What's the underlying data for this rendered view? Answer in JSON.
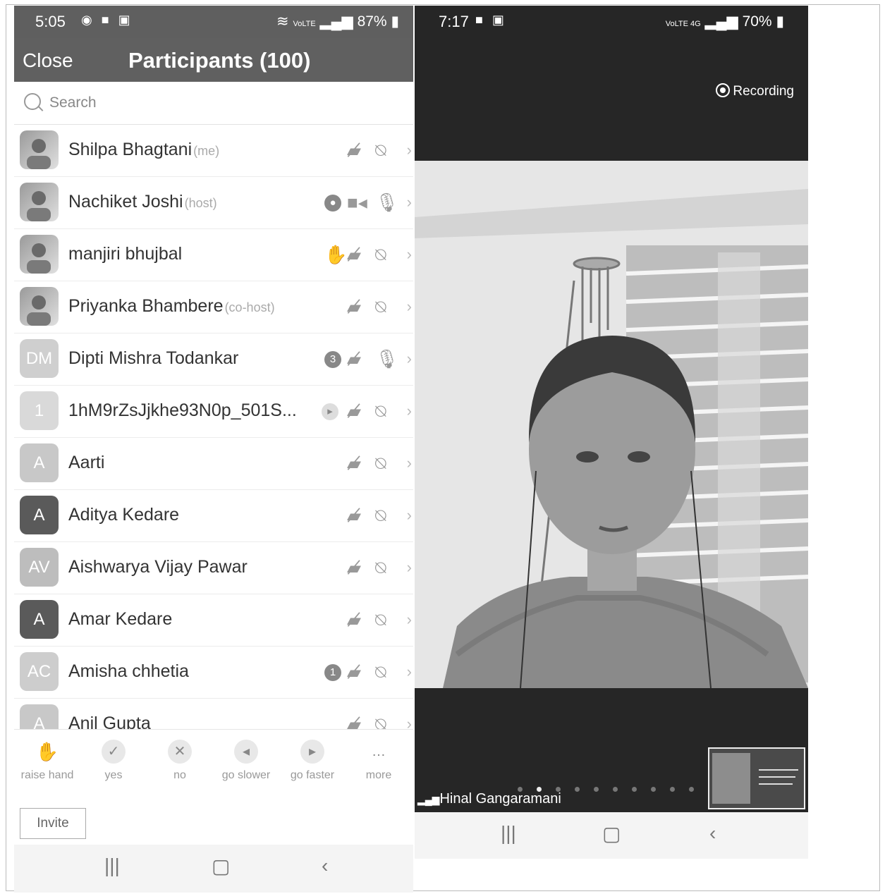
{
  "left_phone": {
    "status": {
      "time": "5:05",
      "indicators": "VoLTE",
      "battery": "87%"
    },
    "header": {
      "close_label": "Close",
      "title": "Participants (100)"
    },
    "search": {
      "placeholder": "Search"
    },
    "participants": [
      {
        "name": "Shilpa Bhagtani",
        "role": "(me)",
        "avatar_type": "photo"
      },
      {
        "name": "Nachiket Joshi",
        "role": "(host)",
        "avatar_type": "photo"
      },
      {
        "name": "manjiri bhujbal",
        "role": "",
        "avatar_type": "photo"
      },
      {
        "name": "Priyanka Bhambere",
        "role": "(co-host)",
        "avatar_type": "photo"
      },
      {
        "name": "Dipti Mishra Todankar",
        "role": "",
        "initials": "DM",
        "badge": "3"
      },
      {
        "name": "1hM9rZsJjkhe93N0p_501S...",
        "role": "",
        "initials": "1"
      },
      {
        "name": "Aarti",
        "role": "",
        "initials": "A"
      },
      {
        "name": "Aditya Kedare",
        "role": "",
        "initials": "A"
      },
      {
        "name": "Aishwarya Vijay Pawar",
        "role": "",
        "initials": "AV"
      },
      {
        "name": "Amar Kedare",
        "role": "",
        "initials": "A"
      },
      {
        "name": "Amisha chhetia",
        "role": "",
        "initials": "AC",
        "badge": "1"
      },
      {
        "name": "Anil Gupta",
        "role": "",
        "initials": "A"
      }
    ],
    "toolbar": [
      {
        "label": "raise hand",
        "icon": "hand-icon"
      },
      {
        "label": "yes",
        "icon": "check-icon"
      },
      {
        "label": "no",
        "icon": "x-icon"
      },
      {
        "label": "go slower",
        "icon": "rewind-icon"
      },
      {
        "label": "go faster",
        "icon": "fast-forward-icon"
      },
      {
        "label": "more",
        "icon": "more-icon"
      }
    ],
    "invite_label": "Invite"
  },
  "right_phone": {
    "status": {
      "time": "7:17",
      "indicators": "VoLTE 4G",
      "battery": "70%"
    },
    "recording_label": "Recording",
    "speaker_name": "Hinal Gangaramani",
    "page_count": 10,
    "active_page": 2
  }
}
